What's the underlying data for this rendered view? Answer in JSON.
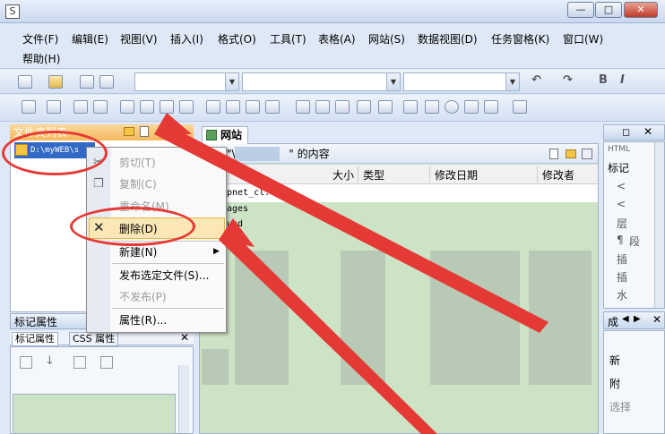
{
  "menu": {
    "items": [
      "文件(F)",
      "编辑(E)",
      "视图(V)",
      "插入(I)",
      "格式(O)",
      "工具(T)",
      "表格(A)",
      "网站(S)",
      "数据视图(D)",
      "任务窗格(K)",
      "窗口(W)",
      "帮助(H)"
    ]
  },
  "left_panel": {
    "title": "文件夹列表",
    "tree_item": "D:\\myWEB\\s"
  },
  "props_panel": {
    "title": "标记属性",
    "tab_tag": "标记属性",
    "tab_css": "CSS 属性"
  },
  "center": {
    "tab": "网站",
    "path_prefix": "\"",
    "path_sep": "\\",
    "path_suffix": "\" 的内容",
    "columns": [
      "大小",
      "类型",
      "修改日期",
      "修改者"
    ],
    "files": [
      "pnet_cl.",
      "ages",
      "und",
      "dio"
    ]
  },
  "right_panel": {
    "html_label": "HTML",
    "section_label": "标记",
    "chars": [
      "<",
      "<",
      "层",
      "¶",
      "段",
      "插",
      "插",
      "水"
    ],
    "lower_title": "成",
    "lower_items": [
      "新",
      "附",
      "选择"
    ]
  },
  "context_menu": {
    "cut": "剪切(T)",
    "copy": "复制(C)",
    "rename": "重命名(M)",
    "delete": "删除(D)",
    "new": "新建(N)",
    "publish": "发布选定文件(S)...",
    "unpublish": "不发布(P)",
    "properties": "属性(R)..."
  },
  "toolbar": {
    "bold": "B",
    "italic": "I"
  },
  "colors": {
    "annotation_red": "#e53935",
    "panel_header_orange": "#f5b85c",
    "selection_blue": "#3169c6",
    "content_green": "#cde3c6"
  }
}
